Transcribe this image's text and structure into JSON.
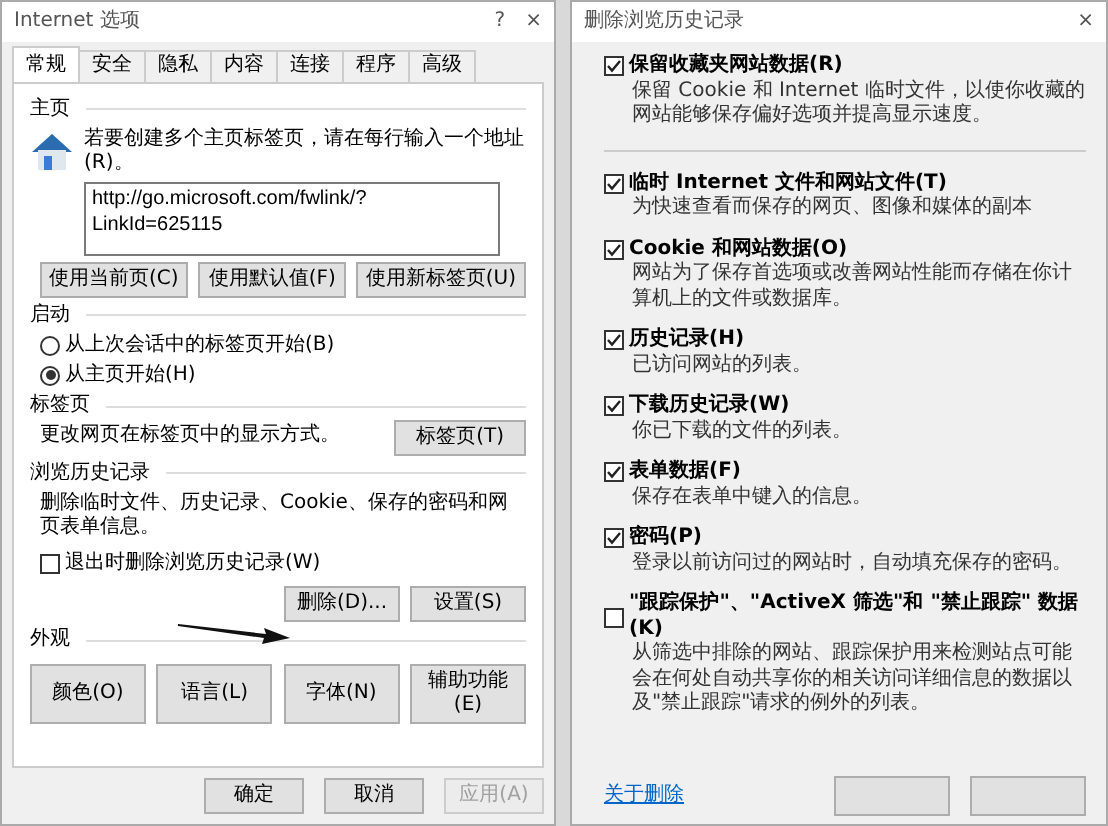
{
  "options_dialog": {
    "title": "Internet 选项",
    "help": "?",
    "close": "×",
    "tabs": [
      {
        "label": "常规",
        "selected": true
      },
      {
        "label": "安全",
        "selected": false
      },
      {
        "label": "隐私",
        "selected": false
      },
      {
        "label": "内容",
        "selected": false
      },
      {
        "label": "连接",
        "selected": false
      },
      {
        "label": "程序",
        "selected": false
      },
      {
        "label": "高级",
        "selected": false
      }
    ],
    "home_page": {
      "heading": "主页",
      "hint": "若要创建多个主页标签页，请在每行输入一个地址(R)。",
      "value": "http://go.microsoft.com/fwlink/?LinkId=625115",
      "buttons": [
        "使用当前页(C)",
        "使用默认值(F)",
        "使用新标签页(U)"
      ]
    },
    "startup": {
      "heading": "启动",
      "options": [
        {
          "label": "从上次会话中的标签页开始(B)",
          "selected": false
        },
        {
          "label": "从主页开始(H)",
          "selected": true
        }
      ]
    },
    "tabs_section": {
      "heading": "标签页",
      "text": "更改网页在标签页中的显示方式。",
      "button": "标签页(T)"
    },
    "history": {
      "heading": "浏览历史记录",
      "text": "删除临时文件、历史记录、Cookie、保存的密码和网页表单信息。",
      "exit_checkbox": {
        "label": "退出时删除浏览历史记录(W)",
        "checked": false
      },
      "buttons": [
        "删除(D)...",
        "设置(S)"
      ]
    },
    "appearance": {
      "heading": "外观",
      "buttons": [
        "颜色(O)",
        "语言(L)",
        "字体(N)",
        "辅助功能(E)"
      ]
    },
    "footer_buttons": [
      {
        "label": "确定",
        "disabled": false
      },
      {
        "label": "取消",
        "disabled": false
      },
      {
        "label": "应用(A)",
        "disabled": true
      }
    ]
  },
  "delete_dialog": {
    "title": "删除浏览历史记录",
    "close": "×",
    "favorites_option": {
      "label": "保留收藏夹网站数据(R)",
      "description": "保留 Cookie 和 Internet 临时文件，以使你收藏的网站能够保存偏好选项并提高显示速度。",
      "checked": true
    },
    "options": [
      {
        "label": "临时 Internet 文件和网站文件(T)",
        "description": "为快速查看而保存的网页、图像和媒体的副本",
        "checked": true
      },
      {
        "label": "Cookie 和网站数据(O)",
        "description": "网站为了保存首选项或改善网站性能而存储在你计算机上的文件或数据库。",
        "checked": true
      },
      {
        "label": "历史记录(H)",
        "description": "已访问网站的列表。",
        "checked": true
      },
      {
        "label": "下载历史记录(W)",
        "description": "你已下载的文件的列表。",
        "checked": true
      },
      {
        "label": "表单数据(F)",
        "description": "保存在表单中键入的信息。",
        "checked": true
      },
      {
        "label": "密码(P)",
        "description": "登录以前访问过的网站时，自动填充保存的密码。",
        "checked": true
      },
      {
        "label": "\"跟踪保护\"、\"ActiveX 筛选\"和 \"禁止跟踪\" 数据(K)",
        "description": "从筛选中排除的网站、跟踪保护用来检测站点可能会在何处自动共享你的相关访问详细信息的数据以及\"禁止跟踪\"请求的例外的列表。",
        "checked": false
      }
    ],
    "link": "关于删除"
  }
}
